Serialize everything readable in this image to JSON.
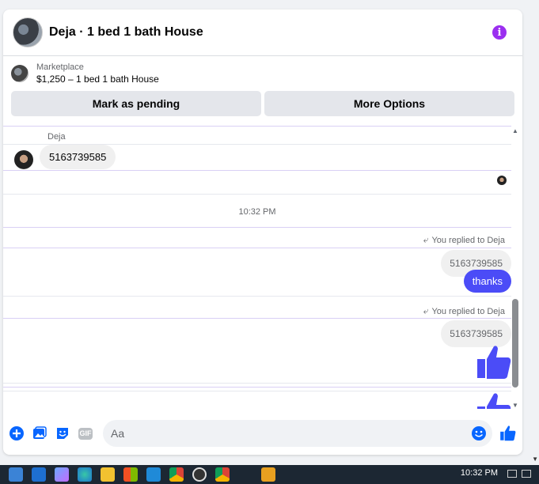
{
  "header": {
    "title": "Deja · 1 bed 1 bath House",
    "info_icon": "info-icon"
  },
  "listing": {
    "source": "Marketplace",
    "title": "$1,250 – 1 bed 1 bath House"
  },
  "actions": {
    "mark_pending": "Mark as pending",
    "more_options": "More Options"
  },
  "messages": {
    "sender_name": "Deja",
    "incoming_text": "5163739585",
    "timestamp": "10:32 PM",
    "reply_label_1": "You replied to Deja",
    "quoted_1": "5163739585",
    "outgoing_1": "thanks",
    "reply_label_2": "You replied to Deja",
    "quoted_2": "5163739585"
  },
  "composer": {
    "placeholder": "Aa",
    "gif_label": "GIF"
  },
  "taskbar": {
    "clock": "10:32 PM"
  },
  "colors": {
    "accent": "#4b4cf7",
    "info": "#9b2ff0",
    "composer_icons": "#0866ff"
  }
}
